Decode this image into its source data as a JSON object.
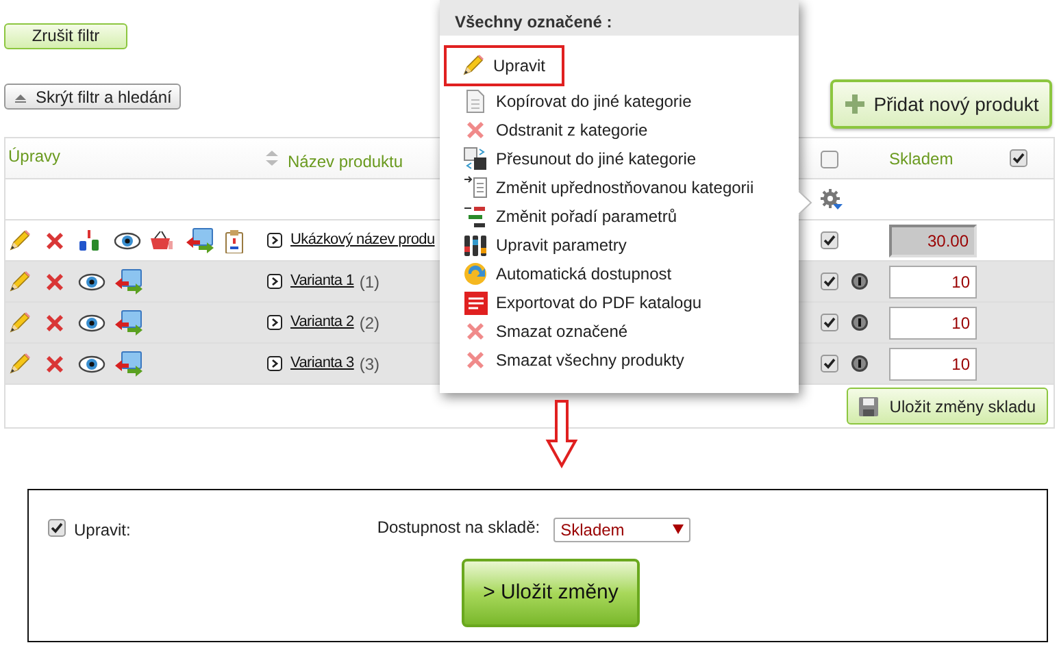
{
  "cancel_filter_button": "Zrušit filtr",
  "hide_filter_button": "Skrýt filtr a hledání",
  "add_product_button": "Přidat nový produkt",
  "table": {
    "columns": [
      {
        "label": "Úpravy"
      },
      {
        "label": "Název produktu"
      },
      {
        "label": "Skladem"
      }
    ],
    "select_all_checked": false,
    "stock_all_checked": true,
    "rows": [
      {
        "kind": "product",
        "name": "Ukázkový název produ",
        "checked": true,
        "stock": "30.00"
      },
      {
        "kind": "variant",
        "name": "Varianta 1",
        "count": "(1)",
        "checked": true,
        "stock": "10"
      },
      {
        "kind": "variant",
        "name": "Varianta 2",
        "count": "(2)",
        "checked": true,
        "stock": "10"
      },
      {
        "kind": "variant",
        "name": "Varianta 3",
        "count": "(3)",
        "checked": true,
        "stock": "10"
      }
    ],
    "save_stock_button": "Uložit změny skladu"
  },
  "menu": {
    "title": "Všechny označené :",
    "items": [
      {
        "label": "Upravit",
        "selected": true
      },
      {
        "label": "Kopírovat do jiné kategorie",
        "selected": false
      },
      {
        "label": "Odstranit z kategorie",
        "selected": false
      },
      {
        "label": "Přesunout do jiné kategorie",
        "selected": false
      },
      {
        "label": "Změnit upřednostňovanou kategorii",
        "selected": false
      },
      {
        "label": "Změnit pořadí parametrů",
        "selected": false
      },
      {
        "label": "Upravit parametry",
        "selected": false
      },
      {
        "label": "Automatická dostupnost",
        "selected": false
      },
      {
        "label": "Exportovat do PDF katalogu",
        "selected": false
      },
      {
        "label": "Smazat označené",
        "selected": false
      },
      {
        "label": "Smazat všechny produkty",
        "selected": false
      }
    ]
  },
  "bulk_edit": {
    "checkbox_label": "Upravit:",
    "checked": true,
    "availability_label": "Dostupnost na skladě:",
    "availability_value": "Skladem",
    "submit_button": "> Uložit změny"
  }
}
